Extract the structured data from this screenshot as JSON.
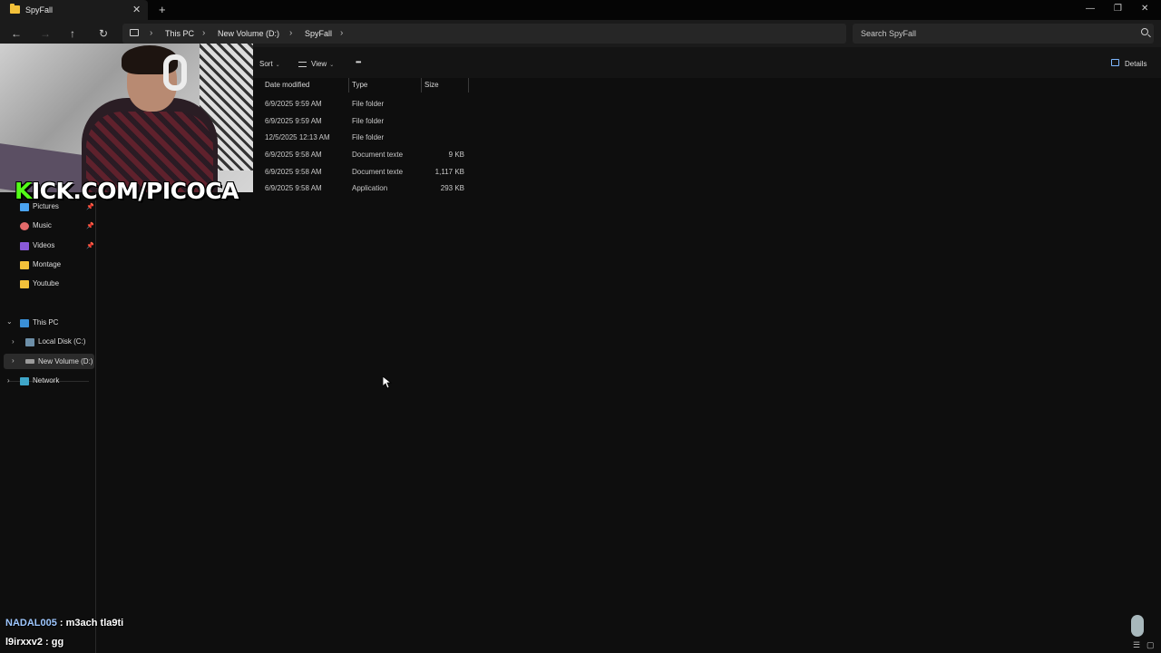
{
  "window": {
    "tab_title": "SpyFall",
    "tab_close": "✕",
    "new_tab": "+",
    "minimize": "—",
    "restore": "❐",
    "close": "✕"
  },
  "nav": {
    "back": "←",
    "forward": "→",
    "up": "↑",
    "refresh": "↻"
  },
  "address": {
    "sep": "›",
    "crumbs": [
      "This PC",
      "New Volume (D:)",
      "SpyFall"
    ]
  },
  "search": {
    "placeholder": "Search SpyFall"
  },
  "toolbar": {
    "sort": "Sort",
    "view": "View",
    "more": "•••",
    "details": "Details",
    "chev": "⌄"
  },
  "columns": [
    "Date modified",
    "Type",
    "Size"
  ],
  "files": [
    {
      "date": "6/9/2025 9:59 AM",
      "type": "File folder",
      "size": ""
    },
    {
      "date": "6/9/2025 9:59 AM",
      "type": "File folder",
      "size": ""
    },
    {
      "date": "12/5/2025 12:13 AM",
      "type": "File folder",
      "size": ""
    },
    {
      "date": "6/9/2025 9:58 AM",
      "type": "Document texte",
      "size": "9 KB"
    },
    {
      "date": "6/9/2025 9:58 AM",
      "type": "Document texte",
      "size": "1,117 KB"
    },
    {
      "date": "6/9/2025 9:58 AM",
      "type": "Application",
      "size": "293 KB"
    }
  ],
  "sidebar": {
    "pinned": [
      {
        "label": "Pictures",
        "color": "#4aa3f0"
      },
      {
        "label": "Music",
        "color": "#e26a6a"
      },
      {
        "label": "Videos",
        "color": "#8a5ad8"
      },
      {
        "label": "Montage",
        "color": "#f3c13a"
      },
      {
        "label": "Youtube",
        "color": "#f3c13a"
      }
    ],
    "pin_glyph": "📌",
    "this_pc": "This PC",
    "drives": [
      "Local Disk (C:)",
      "New Volume (D:)"
    ],
    "network": "Network",
    "expand": "›",
    "collapse": "⌄"
  },
  "overlay": {
    "kick_k": "K",
    "kick_rest": "ICK.COM/PICOCA",
    "chat": [
      {
        "user": "NADAL005",
        "message": " : m3ach tla9ti"
      },
      {
        "user": "l9irxxv2",
        "message": " : gg"
      }
    ]
  },
  "colors": {
    "folder": "#f3c13a",
    "kick_green": "#53fc18",
    "accent": "#7fb8ff"
  }
}
